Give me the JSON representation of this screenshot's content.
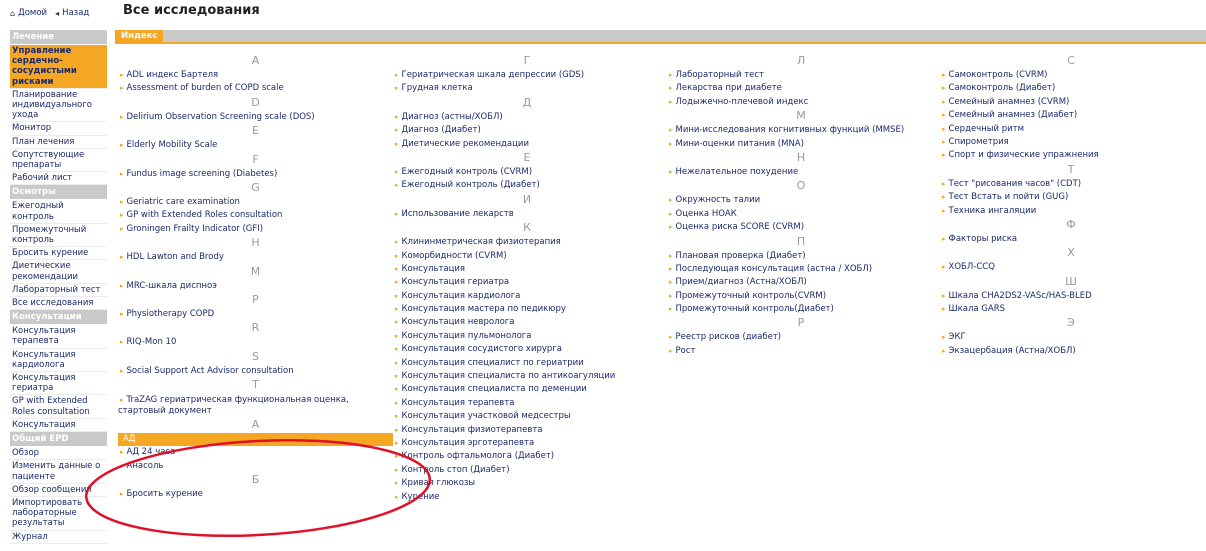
{
  "nav": {
    "home": "Домой",
    "back": "Назад"
  },
  "page_title": "Все исследования",
  "tab": "Индекс",
  "sidebar": [
    {
      "title": "Лечение",
      "items": [
        {
          "label": "Управление сердечно-сосудистыми рисками",
          "active": true
        },
        {
          "label": "Планирование индивидуального ухода"
        },
        {
          "label": "Монитор"
        },
        {
          "label": "План лечения"
        },
        {
          "label": "Сопутствующие препараты"
        },
        {
          "label": "Рабочий лист"
        }
      ]
    },
    {
      "title": "Осмотры",
      "items": [
        {
          "label": "Ежегодный контроль"
        },
        {
          "label": "Промежуточный контроль"
        },
        {
          "label": "Бросить курение"
        },
        {
          "label": "Диетические рекомендации"
        },
        {
          "label": "Лабораторный тест"
        },
        {
          "label": "Все исследования"
        }
      ]
    },
    {
      "title": "Консультации",
      "items": [
        {
          "label": "Консультация терапевта"
        },
        {
          "label": "Консультация кардиолога"
        },
        {
          "label": "Консультация гериатра"
        },
        {
          "label": "GP with Extended Roles consultation"
        },
        {
          "label": "Консультация"
        }
      ]
    },
    {
      "title": "Общий EPD",
      "items": [
        {
          "label": "Обзор"
        },
        {
          "label": "Изменить данные о пациенте"
        },
        {
          "label": "Обзор сообщений"
        },
        {
          "label": "Импортировать лабораторные результаты"
        },
        {
          "label": "Журнал"
        }
      ]
    }
  ],
  "columns": [
    [
      {
        "letter": "A",
        "items": [
          "ADL индекс Бартеля",
          "Assessment of burden of COPD scale"
        ]
      },
      {
        "letter": "D",
        "items": [
          "Delirium Observation Screening scale (DOS)"
        ]
      },
      {
        "letter": "E",
        "items": [
          "Elderly Mobility Scale"
        ]
      },
      {
        "letter": "F",
        "items": [
          "Fundus image screening (Diabetes)"
        ]
      },
      {
        "letter": "G",
        "items": [
          "Geriatric care examination",
          "GP with Extended Roles consultation",
          "Groningen Frailty Indicator (GFI)"
        ]
      },
      {
        "letter": "H",
        "items": [
          "HDL Lawton and Brody"
        ]
      },
      {
        "letter": "M",
        "items": [
          "MRC-шкала диспноэ"
        ]
      },
      {
        "letter": "P",
        "items": [
          "Physiotherapy COPD"
        ]
      },
      {
        "letter": "R",
        "items": [
          "RIQ-Mon 10"
        ]
      },
      {
        "letter": "S",
        "items": [
          "Social Support Act Advisor consultation"
        ]
      },
      {
        "letter": "T",
        "items": [
          "TraZAG гериатрическая функциональная оценка, стартовый документ"
        ]
      },
      {
        "letter": "А",
        "items": [
          "АД",
          "АД 24 часа",
          "Анасоль"
        ]
      },
      {
        "letter": "Б",
        "items": [
          "Бросить курение"
        ]
      }
    ],
    [
      {
        "letter": "Г",
        "items": [
          "Гериатрическая шкала депрессии (GDS)",
          "Грудная клетка"
        ]
      },
      {
        "letter": "Д",
        "items": [
          "Диагноз (астны/ХОБЛ)",
          "Диагноз (Диабет)",
          "Диетические рекомендации"
        ]
      },
      {
        "letter": "Е",
        "items": [
          "Ежегодный контроль (CVRM)",
          "Ежегодный контроль (Диабет)"
        ]
      },
      {
        "letter": "И",
        "items": [
          "Использование лекарств"
        ]
      },
      {
        "letter": "К",
        "items": [
          "Клининметрическая физиотерапия",
          "Коморбидности (CVRM)",
          "Консультация",
          "Консультация гериатра",
          "Консультация кардиолога",
          "Консультация мастера по педикюру",
          "Консультация невролога",
          "Консультация пульмонолога",
          "Консультация сосудистого хирурга",
          "Консультация специалист по гериатрии",
          "Консультация специалиста по антикоагуляции",
          "Консультация специалиста по деменции",
          "Консультация терапевта",
          "Консультация участковой медсестры",
          "Консультация физиотерапевта",
          "Консультация эрготерапевта",
          "Контроль офтальмолога (Диабет)",
          "Контроль стоп (Диабет)",
          "Кривая глюкозы",
          "Курение"
        ]
      }
    ],
    [
      {
        "letter": "Л",
        "items": [
          "Лабораторный тест",
          "Лекарства при диабете",
          "Лодыжечно-плечевой индекс"
        ]
      },
      {
        "letter": "М",
        "items": [
          "Мини-исследования когнитивных функций (MMSE)",
          "Мини-оценки питания (MNA)"
        ]
      },
      {
        "letter": "Н",
        "items": [
          "Нежелательное похудение"
        ]
      },
      {
        "letter": "О",
        "items": [
          "Окружность талии",
          "Оценка НОАК",
          "Оценка риска SCORE (CVRM)"
        ]
      },
      {
        "letter": "П",
        "items": [
          "Плановая проверка (Диабет)",
          "Последующая консультация (астна / ХОБЛ)",
          "Прием/диагноз (Астна/ХОБЛ)",
          "Промежуточный контроль(CVRM)",
          "Промежуточный контроль(Диабет)"
        ]
      },
      {
        "letter": "Р",
        "items": [
          "Реестр рисков (диабет)",
          "Рост"
        ]
      }
    ],
    [
      {
        "letter": "С",
        "items": [
          "Самоконтроль (CVRM)",
          "Самоконтроль (Диабет)",
          "Семейный анамнез (CVRM)",
          "Семейный анамнез (Диабет)",
          "Сердечный ритм",
          "Спирометрия",
          "Спорт и физические упражнения"
        ]
      },
      {
        "letter": "Т",
        "items": [
          "Тест \"рисования часов\" (CDT)",
          "Тест Встать и пойти (GUG)",
          "Техника ингаляции"
        ]
      },
      {
        "letter": "Ф",
        "items": [
          "Факторы риска"
        ]
      },
      {
        "letter": "Х",
        "items": [
          "ХОБЛ-CCQ"
        ]
      },
      {
        "letter": "Ш",
        "items": [
          "Шкала CHA2DS2-VASc/HAS-BLED",
          "Шкала GARS"
        ]
      },
      {
        "letter": "Э",
        "items": [
          "ЭКГ",
          "Экзацербация (Астна/ХОБЛ)"
        ]
      }
    ]
  ],
  "highlighted_item": "АД",
  "colors": {
    "accent": "#f5a623",
    "header_gray": "#c9c9c9",
    "link": "#1a2a6c",
    "annotation": "#e0102a"
  }
}
